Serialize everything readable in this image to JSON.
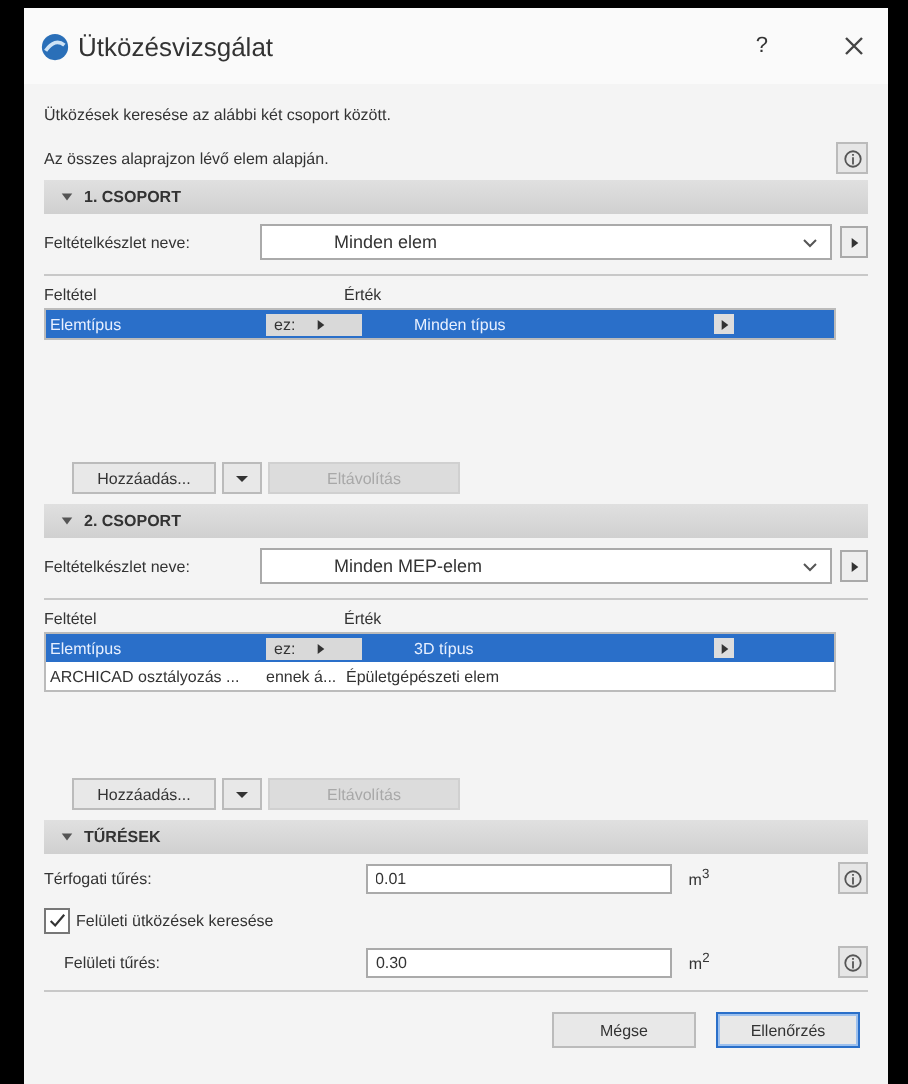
{
  "window": {
    "title": "Ütközésvizsgálat",
    "help": "?"
  },
  "intro": [
    "Ütközések keresése az alábbi két csoport között.",
    "Az összes alaprajzon lévő elem alapján."
  ],
  "groups": [
    {
      "title": "1. CSOPORT",
      "expanded": true,
      "set_label": "Feltételkészlet neve:",
      "set_value": "Minden elem",
      "columns": [
        "Feltétel",
        "Érték"
      ],
      "rows": [
        {
          "condition": "Elemtípus",
          "operator": "ez:",
          "value": "Minden típus",
          "selected": true
        }
      ],
      "add_button": "Hozzáadás...",
      "remove_button": {
        "label": "Eltávolítás",
        "disabled": true
      }
    },
    {
      "title": "2. CSOPORT",
      "expanded": true,
      "set_label": "Feltételkészlet neve:",
      "set_value": "Minden MEP-elem",
      "columns": [
        "Feltétel",
        "Érték"
      ],
      "rows": [
        {
          "condition": "Elemtípus",
          "operator": "ez:",
          "value": "3D típus",
          "selected": true
        },
        {
          "condition": "ARCHICAD osztályozás ...",
          "operator": "ennek á...",
          "value": "Épületgépészeti elem",
          "selected": false
        }
      ],
      "add_button": "Hozzáadás...",
      "remove_button": {
        "label": "Eltávolítás",
        "disabled": true
      }
    }
  ],
  "tolerances": {
    "title": "TŰRÉSEK",
    "expanded": true,
    "volume_label": "Térfogati tűrés:",
    "volume_value": "0.01",
    "volume_unit": "m$^{3}$",
    "surface_check": {
      "label": "Felületi ütközések keresése",
      "checked": true
    },
    "surface_label": "Felületi tűrés:",
    "surface_value": "0.30",
    "surface_unit": "m$^{2}$"
  },
  "buttons": [
    {
      "label": "Mégse",
      "default": false
    },
    {
      "label": "Ellenőrzés",
      "default": true
    }
  ]
}
